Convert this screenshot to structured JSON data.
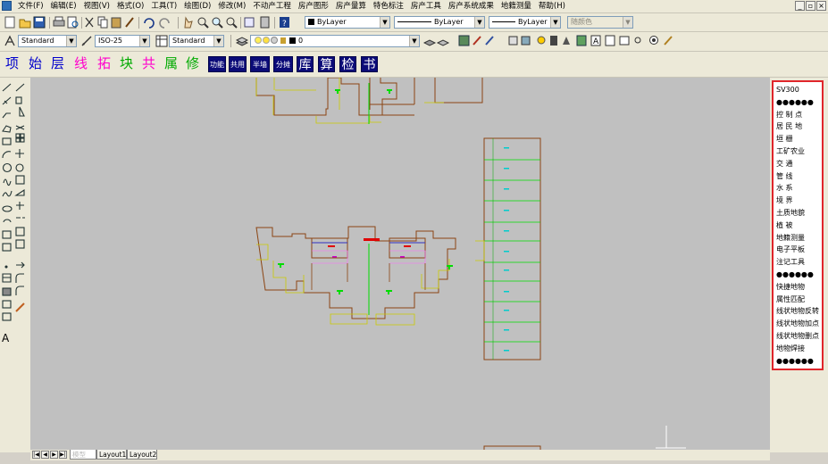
{
  "menu": {
    "items": [
      "文件(F)",
      "编辑(E)",
      "视图(V)",
      "格式(O)",
      "工具(T)",
      "绘图(D)",
      "修改(M)",
      "不动产工程",
      "房产图形",
      "房产量算",
      "特色标注",
      "房产工具",
      "房产系统成果",
      "地籍测量",
      "帮助(H)"
    ],
    "window_buttons": [
      "_",
      "▫",
      "×"
    ]
  },
  "toolbar1": {
    "layer_combo": "ByLayer",
    "linetype_combo": "ByLayer",
    "lineweight_combo": "ByLayer",
    "plotstyle_combo": "随颜色"
  },
  "toolbar2": {
    "text_style": "Standard",
    "dim_style": "ISO-25",
    "table_style": "Standard",
    "layer_name": "0"
  },
  "custom_toolbar": {
    "chars": [
      {
        "text": "项",
        "color": "#0000cc"
      },
      {
        "text": "始",
        "color": "#0000cc"
      },
      {
        "text": "层",
        "color": "#0000cc"
      },
      {
        "text": "线",
        "color": "#ff00cc"
      },
      {
        "text": "拓",
        "color": "#ff00cc"
      },
      {
        "text": "块",
        "color": "#00aa00"
      },
      {
        "text": "共",
        "color": "#ff00cc"
      },
      {
        "text": "属",
        "color": "#00aa00"
      },
      {
        "text": "修",
        "color": "#00aa00"
      }
    ],
    "boxes": [
      "功能",
      "共用",
      "半墙",
      "分摊",
      "库",
      "算",
      "检",
      "书"
    ]
  },
  "right_panel": {
    "items": [
      "SV300",
      "●●●●●●",
      "控 制 点",
      "居 民 地",
      "垣    栅",
      "工矿农业",
      "交    通",
      "管    线",
      "水    系",
      "境    界",
      "土质地貌",
      "植    被",
      "地籍测量",
      "电子平板",
      "注记工具",
      "●●●●●●",
      "快捷地物",
      "属性匹配",
      "线状地物反转",
      "线状地物加点",
      "线状地物删点",
      "地物焊接",
      "●●●●●●"
    ]
  },
  "tabs": {
    "nav": [
      "|◀",
      "◀",
      "▶",
      "▶|"
    ],
    "items": [
      "模型",
      "Layout1",
      "Layout2"
    ]
  },
  "colors": {
    "canvas_bg": "#c0c0c0",
    "wall": "#8b4513",
    "green_line": "#00dd00",
    "yellow_line": "#ffff66",
    "panel_border": "#e0262b"
  }
}
